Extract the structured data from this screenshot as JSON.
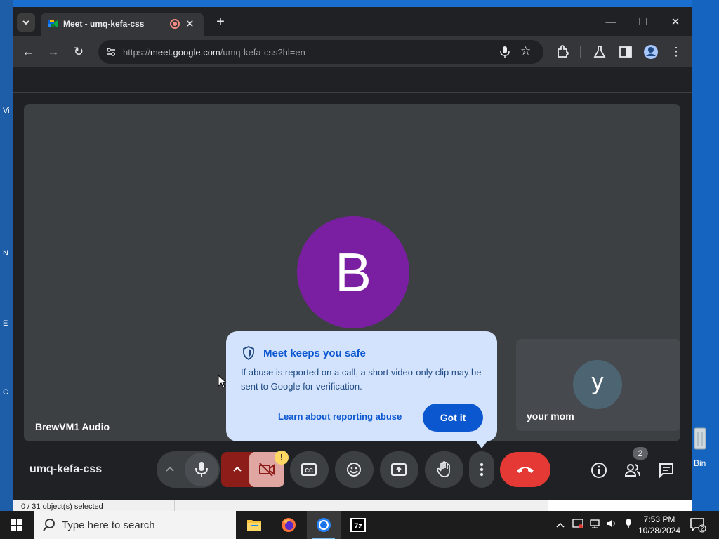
{
  "desktop": {
    "left_fragments": [
      "Vi",
      "N",
      "E",
      "C"
    ],
    "recycle_bin_label": "Bin"
  },
  "explorer": {
    "status": "0 / 31 object(s) selected"
  },
  "browser": {
    "tab_title": "Meet - umq-kefa-css",
    "url_host": "meet.google.com",
    "url_prefix": "https://",
    "url_path": "/umq-kefa-css?hl=en"
  },
  "meet": {
    "main_participant": {
      "initial": "B",
      "name": "BrewVM1 Audio",
      "color": "#7b1fa2"
    },
    "self_tile": {
      "initial": "y",
      "name": "your mom"
    },
    "popup": {
      "title": "Meet keeps you safe",
      "body": "If abuse is reported on a call, a short video-only clip may be sent to Google for verification.",
      "learn_link": "Learn about reporting abuse",
      "got_it": "Got it"
    },
    "meeting_code": "umq-kefa-css",
    "camera_warning": "!",
    "participants_count": "2"
  },
  "taskbar": {
    "search_placeholder": "Type here to search",
    "time": "7:53 PM",
    "date": "10/28/2024",
    "notification_count": "2"
  },
  "colors": {
    "accent": "#0b57d0",
    "hangup": "#e53935",
    "popup_bg": "#d3e3fd"
  }
}
